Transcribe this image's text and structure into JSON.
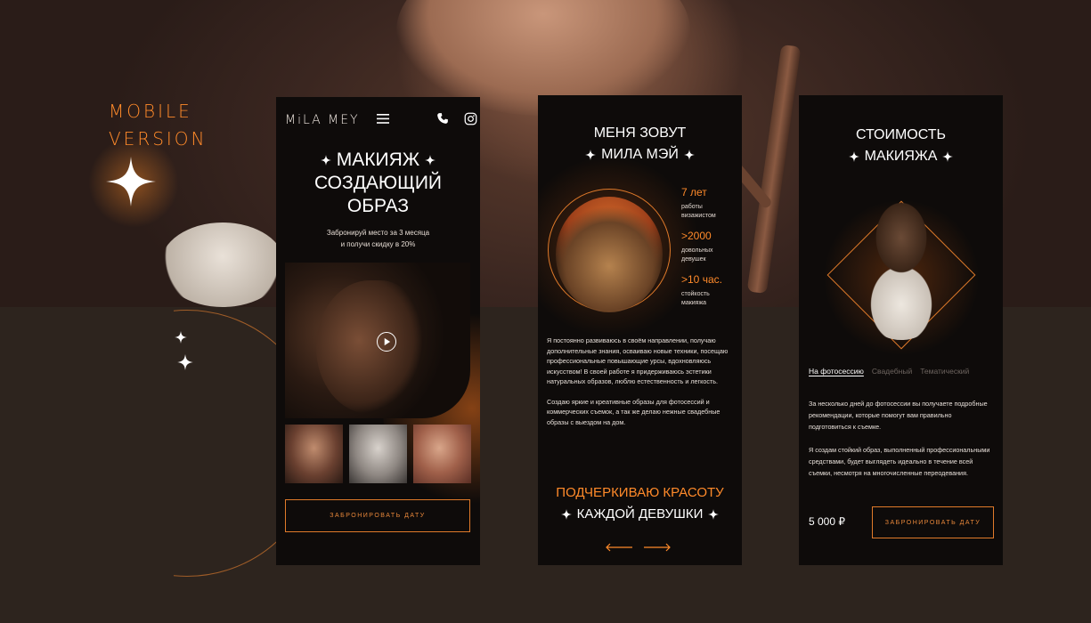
{
  "mobile_label": {
    "line1": "MOBILE",
    "line2": "VERSION"
  },
  "phone1": {
    "logo": "MiLA MEY",
    "icons": {
      "menu": "hamburger-menu-icon",
      "phone": "phone-icon",
      "instagram": "instagram-icon",
      "play": "play-icon"
    },
    "title": {
      "line1": "МАКИЯЖ",
      "line2": "СОЗДАЮЩИЙ",
      "line3": "ОБРАЗ"
    },
    "subtitle": {
      "line1": "Забронируй место за 3 месяца",
      "line2": "и получи скидку в 20%"
    },
    "cta": "ЗАБРОНИРОВАТЬ ДАТУ"
  },
  "phone2": {
    "title": {
      "line1": "МЕНЯ ЗОВУТ",
      "line2": "МИЛА МЭЙ"
    },
    "stats": [
      {
        "num": "7 лет",
        "label": "работы визажистом"
      },
      {
        "num": ">2000",
        "label": "довольных девушек"
      },
      {
        "num": ">10 час.",
        "label": "стойкость макияжа"
      }
    ],
    "body": [
      "Я постоянно развиваюсь в своём направлении, получаю дополнительные знания, осваиваю новые техники, посещаю профессиональные повышающие урсы, вдохновляюсь искусством! В своей работе я придерживаюсь эстетики натуральных образов, люблю естественность и легкость.",
      "Создаю яркие и креативные образы для фотосессий и коммерческих съемок, а так же делаю нежные свадебные образы с выездом на дом."
    ],
    "accent": {
      "line1": "ПОДЧЕРКИВАЮ КРАСОТУ",
      "line2": "КАЖДОЙ ДЕВУШКИ"
    }
  },
  "phone3": {
    "title": {
      "line1": "СТОИМОСТЬ",
      "line2": "МАКИЯЖА"
    },
    "tabs": [
      "На фотосессию",
      "Свадебный",
      "Тематический"
    ],
    "body": [
      "За несколько дней до фотосессии вы получаете подробные рекомендации, которые помогут вам правильно подготовиться к съемке.",
      "Я создам стойкий образ, выполненный профессиональными средствами, будет выглядеть идеально в течение всей съемки, несмотря на многочисленные переодевания."
    ],
    "price": "5 000 ₽",
    "cta": "ЗАБРОНИРОВАТЬ ДАТУ"
  },
  "colors": {
    "accent": "#ff8a2a",
    "panel": "#0e0b0a",
    "background": "#2d241e"
  }
}
